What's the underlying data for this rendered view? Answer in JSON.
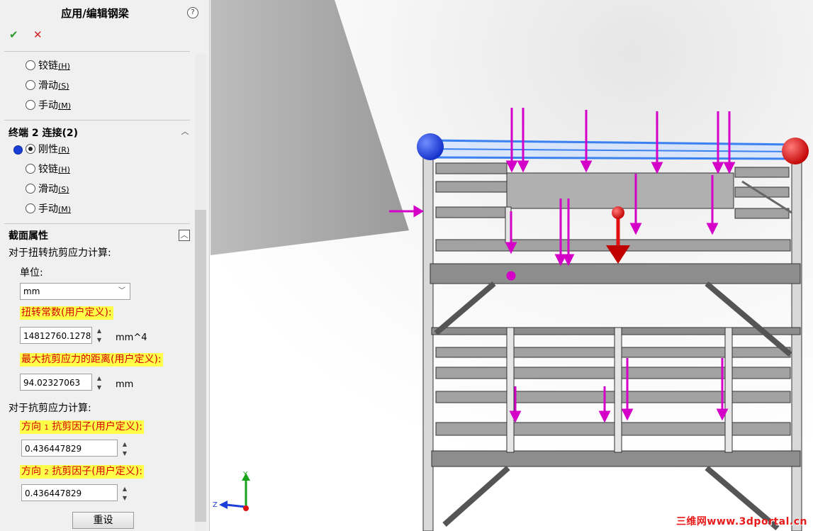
{
  "panel": {
    "title": "应用/编辑钢梁",
    "help_glyph": "?",
    "ok_glyph": "✔",
    "cancel_glyph": "✕",
    "end1_options": [
      {
        "label": "铰链",
        "key": "(H)",
        "selected": false
      },
      {
        "label": "滑动",
        "key": "(S)",
        "selected": false
      },
      {
        "label": "手动",
        "key": "(M)",
        "selected": false
      }
    ],
    "end2": {
      "header": "终端 2 连接(2)",
      "options": [
        {
          "label": "刚性",
          "key": "(R)",
          "selected": true
        },
        {
          "label": "铰链",
          "key": "(H)",
          "selected": false
        },
        {
          "label": "滑动",
          "key": "(S)",
          "selected": false
        },
        {
          "label": "手动",
          "key": "(M)",
          "selected": false
        }
      ]
    },
    "section": {
      "header": "截面属性",
      "torsion_calc_label": "对于扭转抗剪应力计算:",
      "unit_label": "单位:",
      "unit_value": "mm",
      "torsion_constant_label": "扭转常数(用户定义):",
      "torsion_constant_value": "14812760.127823",
      "torsion_constant_unit": "mm^4",
      "max_shear_distance_label": "最大抗剪应力的距离(用户定义):",
      "max_shear_distance_value": "94.02327063",
      "max_shear_distance_unit": "mm",
      "shear_calc_label": "对于抗剪应力计算:",
      "dir1_label_a": "方向",
      "dir1_num": "1",
      "dir1_label_b": "抗剪因子(用户定义):",
      "dir1_value": "0.436447829",
      "dir2_label_a": "方向",
      "dir2_num": "2",
      "dir2_label_b": "抗剪因子(用户定义):",
      "dir2_value": "0.436447829",
      "reset_label": "重设"
    }
  },
  "viewport": {
    "axis_y": "Y",
    "axis_z": "Z",
    "watermark": "三维网www.3dportal.cn",
    "colors": {
      "load_arrow": "#d400c8",
      "beam_highlight": "#3b82f0",
      "node_blue": "#1536d8",
      "node_red": "#e01010",
      "frame": "#8a8a8a"
    }
  }
}
